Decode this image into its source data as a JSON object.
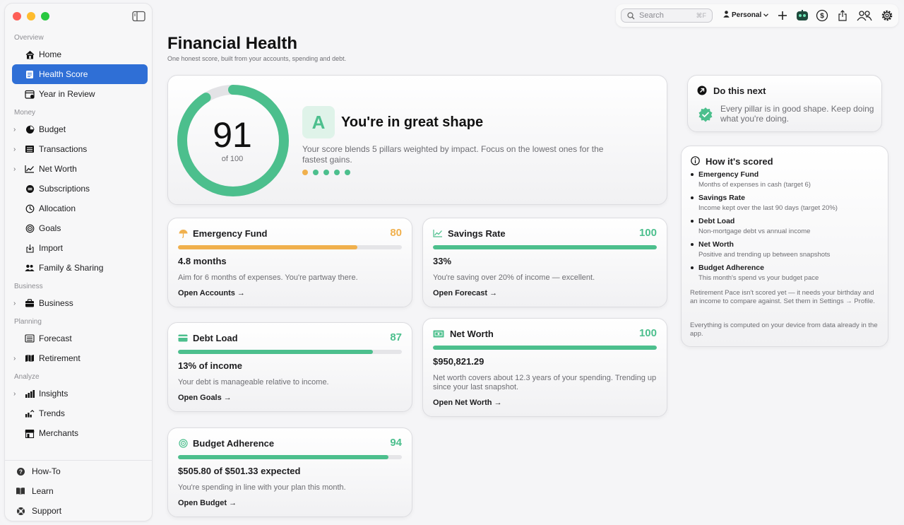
{
  "sidebar": {
    "sections": {
      "overview": "Overview",
      "money": "Money",
      "business": "Business",
      "planning": "Planning",
      "analyze": "Analyze"
    },
    "items": {
      "home": "Home",
      "health_score": "Health Score",
      "year_in_review": "Year in Review",
      "budget": "Budget",
      "transactions": "Transactions",
      "net_worth": "Net Worth",
      "subscriptions": "Subscriptions",
      "allocation": "Allocation",
      "goals": "Goals",
      "import": "Import",
      "family_sharing": "Family & Sharing",
      "business": "Business",
      "forecast": "Forecast",
      "retirement": "Retirement",
      "insights": "Insights",
      "trends": "Trends",
      "merchants": "Merchants"
    },
    "footer": {
      "howto": "How-To",
      "learn": "Learn",
      "support": "Support"
    },
    "active_color": "#2f6fd6"
  },
  "toolbar": {
    "search_placeholder": "Search",
    "search_shortcut": "⌘F",
    "profile": "Personal"
  },
  "page": {
    "title": "Financial Health",
    "subtitle": "One honest score, built from your accounts, spending and debt."
  },
  "score": {
    "value": "91",
    "of": "of 100",
    "fraction": 0.91,
    "grade": "A",
    "headline": "You're in great shape",
    "description": "Your score blends 5 pillars weighted by impact. Focus on the lowest ones for the fastest gains.",
    "dot_colors": [
      "#f0b04d",
      "#4cbf8d",
      "#4cbf8d",
      "#4cbf8d",
      "#4cbf8d"
    ],
    "ring_color": "#4cbf8d"
  },
  "pillars": {
    "emergency": {
      "title": "Emergency Fund",
      "score": "80",
      "fraction": 0.8,
      "color": "#f0b04d",
      "metric": "4.8 months",
      "desc": "Aim for 6 months of expenses. You're partway there.",
      "link": "Open Accounts →"
    },
    "savings": {
      "title": "Savings Rate",
      "score": "100",
      "fraction": 1.0,
      "color": "#4cbf8d",
      "metric": "33%",
      "desc": "You're saving over 20% of income — excellent.",
      "link": "Open Forecast →"
    },
    "debt": {
      "title": "Debt Load",
      "score": "87",
      "fraction": 0.87,
      "color": "#4cbf8d",
      "metric": "13% of income",
      "desc": "Your debt is manageable relative to income.",
      "link": "Open Goals →"
    },
    "networth": {
      "title": "Net Worth",
      "score": "100",
      "fraction": 1.0,
      "color": "#4cbf8d",
      "metric": "$950,821.29",
      "desc": "Net worth covers about 12.3 years of your spending. Trending up since your last snapshot.",
      "link": "Open Net Worth →"
    },
    "budget": {
      "title": "Budget Adherence",
      "score": "94",
      "fraction": 0.94,
      "color": "#4cbf8d",
      "metric": "$505.80 of $501.33 expected",
      "desc": "You're spending in line with your plan this month.",
      "link": "Open Budget →"
    }
  },
  "next": {
    "title": "Do this next",
    "body": "Every pillar is in good shape. Keep doing what you're doing."
  },
  "scored": {
    "title": "How it's scored",
    "items": [
      {
        "name": "Emergency Fund",
        "desc": "Months of expenses in cash (target 6)"
      },
      {
        "name": "Savings Rate",
        "desc": "Income kept over the last 90 days (target 20%)"
      },
      {
        "name": "Debt Load",
        "desc": "Non-mortgage debt vs annual income"
      },
      {
        "name": "Net Worth",
        "desc": "Positive and trending up between snapshots"
      },
      {
        "name": "Budget Adherence",
        "desc": "This month's spend vs your budget pace"
      }
    ],
    "note1": "Retirement Pace isn't scored yet — it needs your birthday and an income to compare against. Set them in Settings → Profile.",
    "note2": "Everything is computed on your device from data already in the app."
  }
}
